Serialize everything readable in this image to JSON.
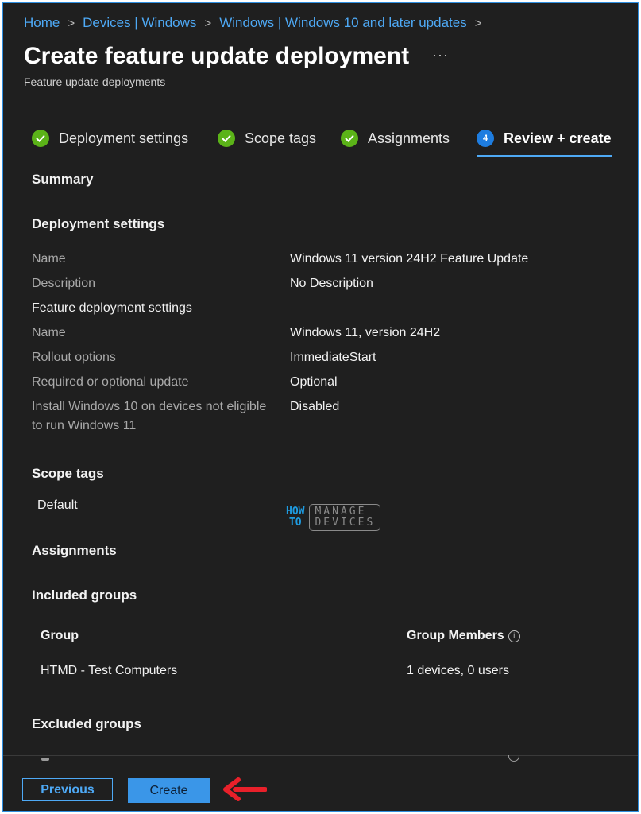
{
  "breadcrumb": [
    "Home",
    "Devices | Windows",
    "Windows | Windows 10 and later updates"
  ],
  "page": {
    "title": "Create feature update deployment",
    "subtitle": "Feature update deployments",
    "more": "···"
  },
  "steps": [
    {
      "number": "",
      "label": "Deployment settings",
      "state": "done"
    },
    {
      "number": "",
      "label": "Scope tags",
      "state": "done"
    },
    {
      "number": "",
      "label": "Assignments",
      "state": "done"
    },
    {
      "number": "4",
      "label": "Review + create",
      "state": "active"
    }
  ],
  "summary": {
    "title": "Summary",
    "deployment_settings": {
      "heading": "Deployment settings",
      "name_label": "Name",
      "name_value": "Windows 11 version 24H2 Feature Update",
      "description_label": "Description",
      "description_value": "No Description",
      "feature_heading": "Feature deployment settings",
      "feature_name_label": "Name",
      "feature_name_value": "Windows 11, version 24H2",
      "rollout_label": "Rollout options",
      "rollout_value": "ImmediateStart",
      "required_label": "Required or optional update",
      "required_value": "Optional",
      "install_label_line1": "Install Windows 10 on devices not eligible",
      "install_label_line2": "to run Windows 11",
      "install_value": "Disabled"
    },
    "scope_tags": {
      "heading": "Scope tags",
      "value": "Default"
    },
    "assignments": {
      "heading": "Assignments",
      "included_heading": "Included groups",
      "columns": [
        "Group",
        "Group Members"
      ],
      "rows": [
        {
          "group": "HTMD - Test Computers",
          "members": "1 devices, 0 users"
        }
      ],
      "excluded_heading": "Excluded groups"
    }
  },
  "watermark": {
    "how": "HOW",
    "to": "TO",
    "manage": "MANAGE",
    "devices": "DEVICES"
  },
  "footer": {
    "previous_label": "Previous",
    "create_label": "Create"
  },
  "colors": {
    "accent": "#4ea9f5",
    "primary_button": "#3a96e8",
    "success": "#5bb318",
    "background": "#1f1f1f",
    "annotation_arrow": "#e8202a"
  }
}
